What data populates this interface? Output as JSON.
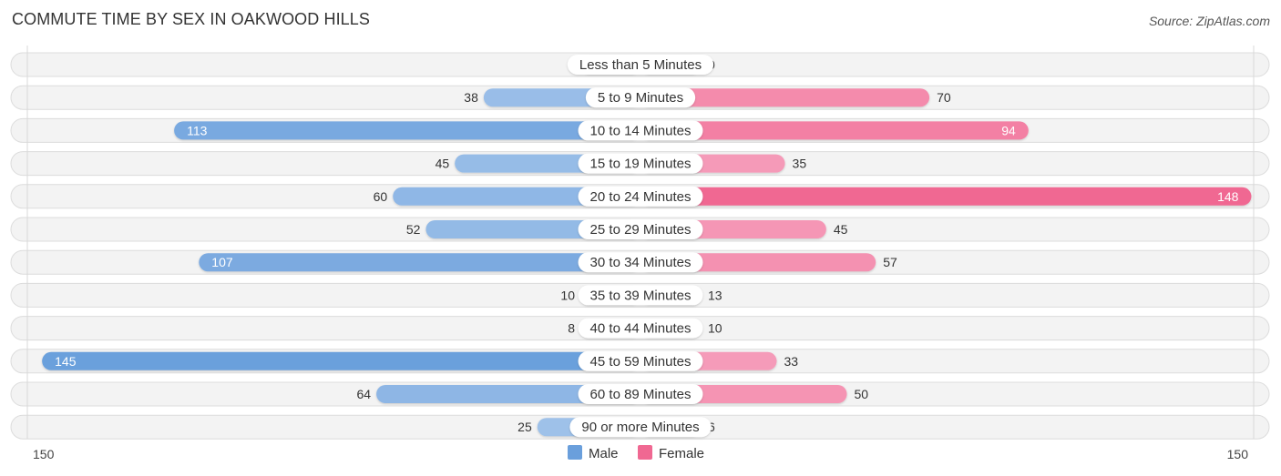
{
  "header": {
    "title": "COMMUTE TIME BY SEX IN OAKWOOD HILLS",
    "source": "Source: ZipAtlas.com"
  },
  "chart_data": {
    "type": "bar",
    "orientation": "horizontal-diverging",
    "title": "COMMUTE TIME BY SEX IN OAKWOOD HILLS",
    "categories": [
      "Less than 5 Minutes",
      "5 to 9 Minutes",
      "10 to 14 Minutes",
      "15 to 19 Minutes",
      "20 to 24 Minutes",
      "25 to 29 Minutes",
      "30 to 34 Minutes",
      "35 to 39 Minutes",
      "40 to 44 Minutes",
      "45 to 59 Minutes",
      "60 to 89 Minutes",
      "90 or more Minutes"
    ],
    "series": [
      {
        "name": "Male",
        "side": "left",
        "color": "#6a9fdc",
        "light_color": "#a9c8ec",
        "values": [
          0,
          38,
          113,
          45,
          60,
          52,
          107,
          10,
          8,
          145,
          64,
          25
        ]
      },
      {
        "name": "Female",
        "side": "right",
        "color": "#f06892",
        "light_color": "#f7aac4",
        "values": [
          0,
          70,
          94,
          35,
          148,
          45,
          57,
          13,
          10,
          33,
          50,
          6
        ]
      }
    ],
    "axis": {
      "min_label": "150",
      "max_label": "150",
      "range": [
        0,
        150
      ]
    },
    "legend": {
      "position": "bottom-center",
      "items": [
        "Male",
        "Female"
      ]
    },
    "xlabel": "",
    "ylabel": ""
  }
}
